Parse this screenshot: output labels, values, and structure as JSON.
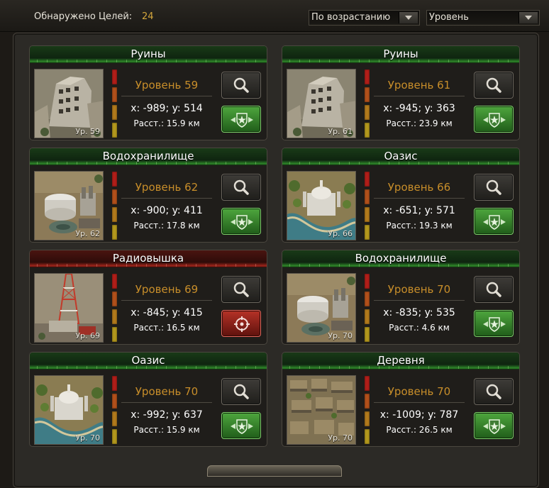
{
  "header": {
    "found_label": "Обнаружено Целей:",
    "found_count": "24",
    "sort_order": "По возрастанию",
    "sort_field": "Уровень"
  },
  "targets": [
    {
      "name": "Руины",
      "level_text": "Уровень 59",
      "coords": "x: -989; y: 514",
      "distance": "Расст.: 15.9 км",
      "thumb_label": "Ур. 59",
      "type": "ruins",
      "state": "green"
    },
    {
      "name": "Руины",
      "level_text": "Уровень 61",
      "coords": "x: -945; y: 363",
      "distance": "Расст.: 23.9 км",
      "thumb_label": "Ур. 61",
      "type": "ruins",
      "state": "green"
    },
    {
      "name": "Водохранилище",
      "level_text": "Уровень 62",
      "coords": "x: -900; y: 411",
      "distance": "Расст.: 17.8 км",
      "thumb_label": "Ур. 62",
      "type": "reservoir",
      "state": "green"
    },
    {
      "name": "Оазис",
      "level_text": "Уровень 66",
      "coords": "x: -651; y: 571",
      "distance": "Расст.: 19.3 км",
      "thumb_label": "Ур. 66",
      "type": "oasis",
      "state": "green"
    },
    {
      "name": "Радиовышка",
      "level_text": "Уровень 69",
      "coords": "x: -845; y: 415",
      "distance": "Расст.: 16.5 км",
      "thumb_label": "Ур. 69",
      "type": "tower",
      "state": "red"
    },
    {
      "name": "Водохранилище",
      "level_text": "Уровень 70",
      "coords": "x: -835; y: 535",
      "distance": "Расст.: 4.6 км",
      "thumb_label": "Ур. 70",
      "type": "reservoir",
      "state": "green"
    },
    {
      "name": "Оазис",
      "level_text": "Уровень 70",
      "coords": "x: -992; y: 637",
      "distance": "Расст.: 15.9 км",
      "thumb_label": "Ур. 70",
      "type": "oasis",
      "state": "green"
    },
    {
      "name": "Деревня",
      "level_text": "Уровень 70",
      "coords": "x: -1009; y: 787",
      "distance": "Расст.: 26.5 км",
      "thumb_label": "Ур. 70",
      "type": "village",
      "state": "green"
    }
  ],
  "icons": {
    "search": "magnifier-icon",
    "green_action": "shield-star-icon",
    "red_action": "crosshair-icon"
  },
  "colors": {
    "accent_gold": "#c88e2a",
    "header_green": "#2f8a2a",
    "header_red": "#a3261c"
  }
}
